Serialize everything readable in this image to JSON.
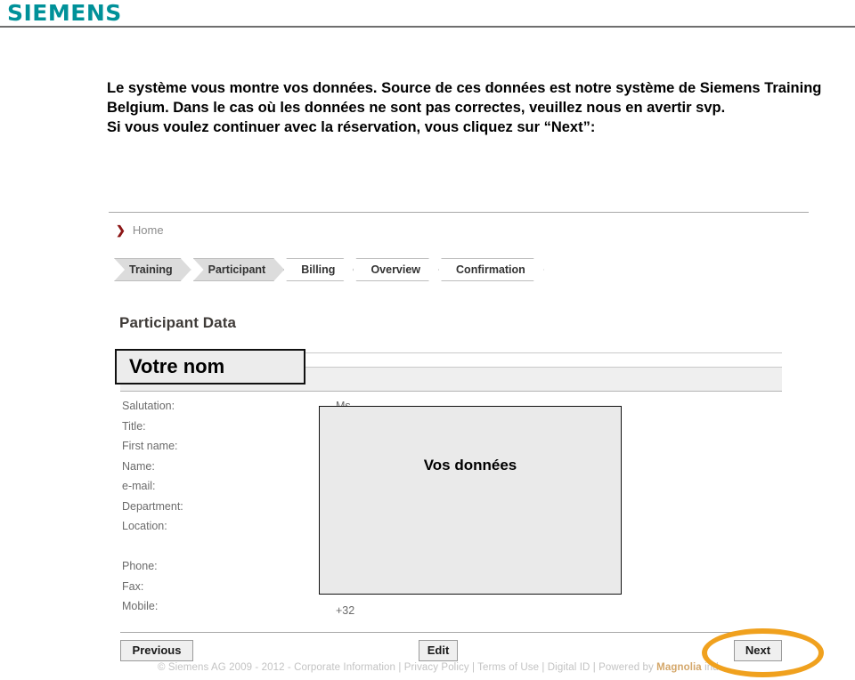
{
  "header": {
    "logo_text": "SIEMENS",
    "logo_color": "#009199"
  },
  "slide": {
    "paragraph_1_a": "Le système vous montre vos données. Source de ces données est notre système de Siemens Training Belgium. Dans le cas où les données ne sont pas correctes, veuillez nous en avertir svp.",
    "paragraph_2_before": "Si vous voulez continuer avec la réservation, vous cliquez sur “",
    "paragraph_2_keyword": "Next",
    "paragraph_2_after": "”:"
  },
  "app": {
    "breadcrumb": {
      "chevron": "❯",
      "home_label": "Home"
    },
    "steps": [
      {
        "label": "Training",
        "state": "done"
      },
      {
        "label": "Participant",
        "state": "done"
      },
      {
        "label": "Billing",
        "state": "todo"
      },
      {
        "label": "Overview",
        "state": "todo"
      },
      {
        "label": "Confirmation",
        "state": "todo"
      }
    ],
    "page_title": "Participant Data",
    "form": {
      "labels": [
        "Salutation:",
        "Title:",
        "First name:",
        "Name:",
        "e-mail:",
        "Department:",
        "Location:",
        "Phone:",
        "Fax:",
        "Mobile:"
      ],
      "values": {
        "salutation": "Ms",
        "mobile": "+32"
      }
    },
    "buttons": {
      "previous": "Previous",
      "edit": "Edit",
      "next": "Next"
    },
    "footer": {
      "legal_main": "© Siemens AG 2009 - 2012 - Corporate Information | Privacy Policy | Terms of Use | Digital ID | Powered by ",
      "legal_brand": "Magnolia",
      "legal_tail": " ind"
    }
  },
  "annotations": {
    "votre_nom": "Votre nom",
    "vos_donnees": "Vos données",
    "highlight_color": "#F0A11E"
  }
}
